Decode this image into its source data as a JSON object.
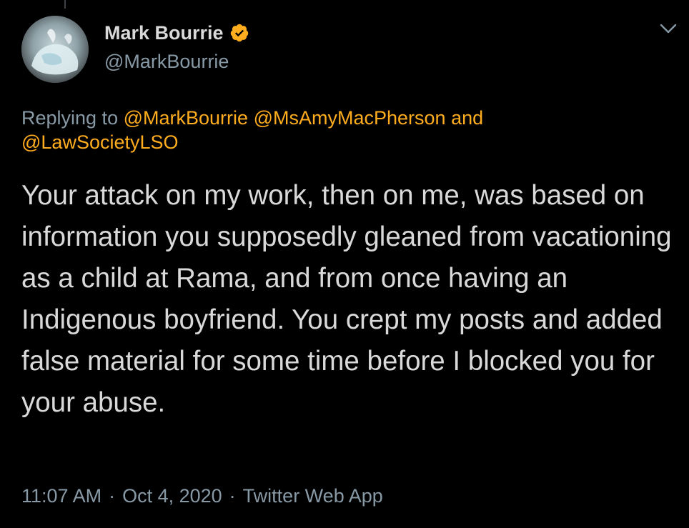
{
  "tweet": {
    "author": {
      "display_name": "Mark Bourrie",
      "handle": "@MarkBourrie",
      "verified": true,
      "avatar_icon": "profile-photo-icon"
    },
    "reply_context": {
      "prefix": "Replying to",
      "mentions": [
        "@MarkBourrie",
        "@MsAmyMacPherson"
      ],
      "conjunction": "and",
      "last_mention": "@LawSocietyLSO"
    },
    "text": "Your attack on my work, then on me, was based on information you supposedly gleaned from vacationing as a child at Rama, and from once having an Indigenous boyfriend. You crept my posts and added false material for some time before I blocked you for your abuse.",
    "time": "11:07 AM",
    "separator": "·",
    "date": "Oct 4, 2020",
    "source": "Twitter Web App"
  },
  "colors": {
    "background": "#000000",
    "text_primary": "#d9d9d9",
    "text_secondary": "#8899a6",
    "mention": "#ffad1f",
    "verified_badge": "#ffad1f"
  },
  "icons": {
    "verified": "verified-badge-icon",
    "menu": "chevron-down-icon"
  }
}
